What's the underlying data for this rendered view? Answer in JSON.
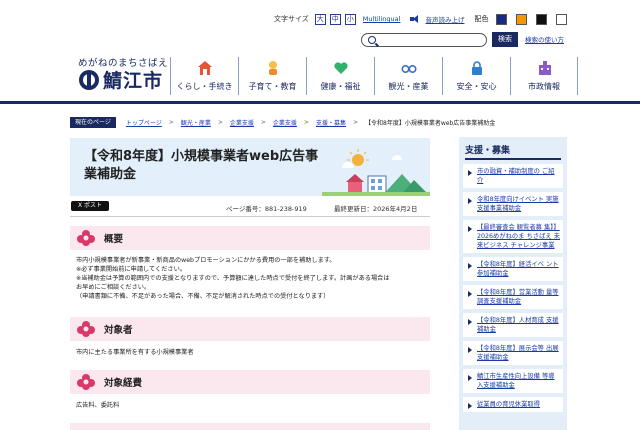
{
  "utility": {
    "font_size_label": "文字サイズ",
    "font_sizes": [
      "大",
      "中",
      "小"
    ],
    "multilingual": "Multilingual",
    "read_aloud": "音声読み上げ",
    "color_label": "配色",
    "colors": [
      "#1a2a80",
      "#f39800",
      "#111111",
      "#ffffff"
    ]
  },
  "search": {
    "placeholder": "",
    "button": "検索",
    "help": "検索の使い方"
  },
  "logo": {
    "kana": "めがねのまちさばえ",
    "name": "鯖江市"
  },
  "nav": [
    {
      "label": "くらし・手続き",
      "icon": "house-icon"
    },
    {
      "label": "子育て・教育",
      "icon": "child-icon"
    },
    {
      "label": "健康・福祉",
      "icon": "heart-icon"
    },
    {
      "label": "観光・産業",
      "icon": "glasses-icon"
    },
    {
      "label": "安全・安心",
      "icon": "lock-icon"
    },
    {
      "label": "市政情報",
      "icon": "building-icon"
    }
  ],
  "breadcrumb": {
    "now_label": "現在のページ",
    "items": [
      "トップページ",
      "観光・産業",
      "企業支援",
      "企業支援",
      "支援・募集"
    ],
    "current": "【令和8年度】小規模事業者web広告事業補助金"
  },
  "article": {
    "title": "【令和8年度】小規模事業者web広告事業補助金",
    "share": "X ポスト",
    "page_number": "ページ番号：881-238-919",
    "updated": "最終更新日：2026年4月2日",
    "sections": [
      {
        "heading": "概要",
        "lines": [
          "市内小規模事業者が新事業・新商品のwebプロモーションにかかる費用の一部を補助します。",
          "※必ず事業開始前に申請してください。",
          "※当補助金は予算の範囲内での支援となりますので、予算額に達した時点で受付を終了します。計画がある場合は",
          "お早めにご相談ください。",
          "（申請書類に不備、不足があった場合、不備、不足が解消された時点での受付となります）"
        ]
      },
      {
        "heading": "対象者",
        "lines": [
          "市内に主たる事業所を有する小規模事業者"
        ]
      },
      {
        "heading": "対象経費",
        "lines": [
          "広告料、委託料"
        ]
      }
    ]
  },
  "sidebar": {
    "heading": "支援・募集",
    "items": [
      "市の融資・補助制度の ご紹介",
      "令和8年度向けイベント 実施支援事業補助金",
      "【最終審査会 観覧者募 集】】2026めがねのま ちさばえ 未来ビジネス チャレンジ事業",
      "【令和8年度】経活イベ ント参加補助金",
      "【令和8年度】営業活動 量等調査支援補助金",
      "【令和8年度】人材育成 支援補助金",
      "【令和8年度】展示会等 出展支援補助金",
      "鯖江市生産性向上設備 等導入支援補助金",
      "従業員の育児休業取得"
    ]
  }
}
